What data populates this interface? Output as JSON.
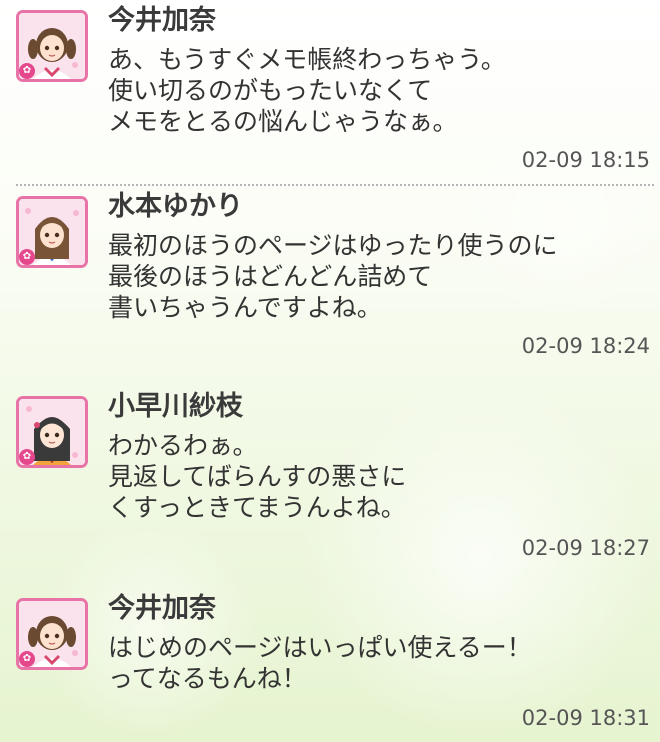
{
  "messages": [
    {
      "name": "今井加奈",
      "avatar": "avatar-kana",
      "lines": [
        "あ、もうすぐメモ帳終わっちゃう。",
        "使い切るのがもったいなくて",
        "メモをとるの悩んじゃうなぁ。"
      ],
      "time": "02-09 18:15"
    },
    {
      "name": "水本ゆかり",
      "avatar": "avatar-yukari",
      "lines": [
        "最初のほうのページはゆったり使うのに",
        "最後のほうはどんどん詰めて",
        "書いちゃうんですよね。"
      ],
      "time": "02-09 18:24"
    },
    {
      "name": "小早川紗枝",
      "avatar": "avatar-sae",
      "lines": [
        "わかるわぁ。",
        "見返してばらんすの悪さに",
        "くすっときてまうんよね。"
      ],
      "time": "02-09 18:27"
    },
    {
      "name": "今井加奈",
      "avatar": "avatar-kana",
      "lines": [
        "はじめのページはいっぱい使えるー！",
        "ってなるもんね！"
      ],
      "time": "02-09 18:31"
    }
  ],
  "badge_icon": "flower-icon",
  "colors": {
    "avatar_border": "#e873a6",
    "badge": "#e4478c",
    "background_bottom": "#e6f4d0"
  }
}
